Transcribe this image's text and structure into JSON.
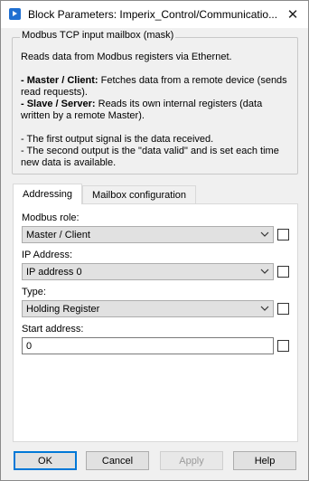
{
  "window": {
    "title": "Block Parameters: Imperix_Control/Communicatio..."
  },
  "description": {
    "legend": "Modbus TCP input mailbox (mask)",
    "intro": "Reads data from Modbus registers via Ethernet.",
    "master_bold": "- Master / Client:",
    "master_text": " Fetches data from a remote device (sends read requests).",
    "slave_bold": "- Slave / Server:",
    "slave_text": " Reads its own internal registers (data written by a remote Master).",
    "output1": "- The first output signal is the data received.",
    "output2": "- The second output is the \"data valid\" and is set each time new data is available."
  },
  "tabs": [
    {
      "label": "Addressing"
    },
    {
      "label": "Mailbox configuration"
    }
  ],
  "fields": {
    "modbus_role": {
      "label": "Modbus role:",
      "value": "Master / Client"
    },
    "ip_address": {
      "label": "IP Address:",
      "value": "IP address 0"
    },
    "type": {
      "label": "Type:",
      "value": "Holding Register"
    },
    "start_address": {
      "label": "Start address:",
      "value": "0"
    }
  },
  "buttons": {
    "ok": "OK",
    "cancel": "Cancel",
    "apply": "Apply",
    "help": "Help"
  },
  "colors": {
    "accent": "#0078d7",
    "icon": "#1f6fd1"
  }
}
